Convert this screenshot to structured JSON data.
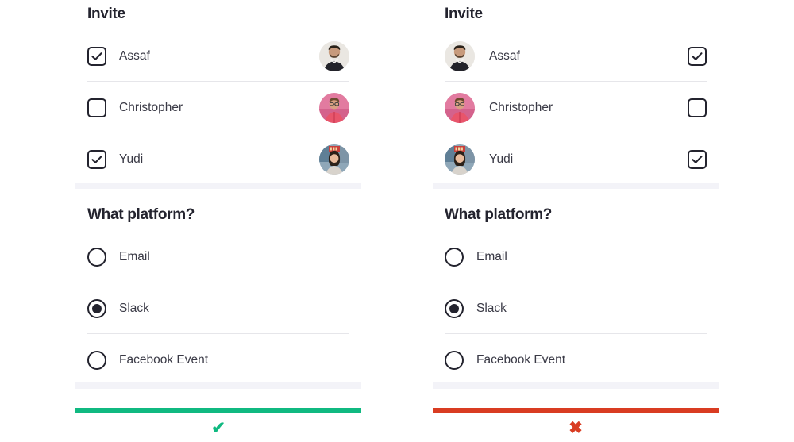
{
  "panels": [
    {
      "id": "approved",
      "layout": "checkbox-first",
      "invite": {
        "title": "Invite",
        "people": [
          {
            "name": "Assaf",
            "checked": true,
            "avatar": "avatar-assaf"
          },
          {
            "name": "Christopher",
            "checked": false,
            "avatar": "avatar-christopher"
          },
          {
            "name": "Yudi",
            "checked": true,
            "avatar": "avatar-yudi"
          }
        ]
      },
      "platform": {
        "title": "What platform?",
        "options": [
          {
            "label": "Email",
            "selected": false
          },
          {
            "label": "Slack",
            "selected": true
          },
          {
            "label": "Facebook Event",
            "selected": false
          }
        ]
      },
      "verdict": {
        "mark": "✔",
        "icon_name": "check-mark-icon",
        "color": "#10b981"
      }
    },
    {
      "id": "rejected",
      "layout": "avatar-first",
      "invite": {
        "title": "Invite",
        "people": [
          {
            "name": "Assaf",
            "checked": true,
            "avatar": "avatar-assaf"
          },
          {
            "name": "Christopher",
            "checked": false,
            "avatar": "avatar-christopher"
          },
          {
            "name": "Yudi",
            "checked": true,
            "avatar": "avatar-yudi"
          }
        ]
      },
      "platform": {
        "title": "What platform?",
        "options": [
          {
            "label": "Email",
            "selected": false
          },
          {
            "label": "Slack",
            "selected": true
          },
          {
            "label": "Facebook Event",
            "selected": false
          }
        ]
      },
      "verdict": {
        "mark": "✖",
        "icon_name": "cross-mark-icon",
        "color": "#d93c22"
      }
    }
  ],
  "colors": {
    "text": "#23232e",
    "label": "#3a3a46",
    "divider": "#e6e6ea",
    "band": "#f3f3f8",
    "approved": "#10b981",
    "rejected": "#d93c22",
    "background": "#ffffff"
  }
}
